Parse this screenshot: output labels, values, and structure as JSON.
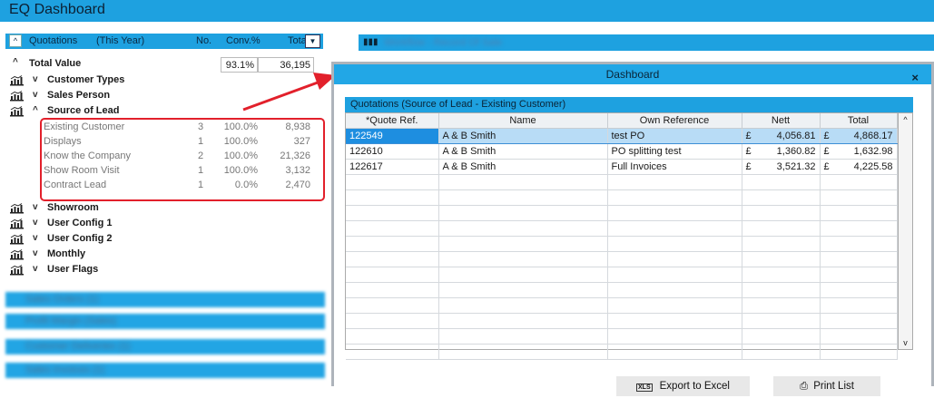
{
  "app": {
    "title": "EQ Dashboard"
  },
  "quotations": {
    "title": "Quotations",
    "period": "(This Year)",
    "col_no": "No.",
    "col_conv": "Conv.%",
    "col_total": "Total £",
    "total_label": "Total Value",
    "total_conv": "93.1%",
    "total_value": "36,195",
    "groups": [
      {
        "label": "Customer Types",
        "expanded": false
      },
      {
        "label": "Sales Person",
        "expanded": false
      },
      {
        "label": "Source of Lead",
        "expanded": true
      },
      {
        "label": "Showroom",
        "expanded": false
      },
      {
        "label": "User Config 1",
        "expanded": false
      },
      {
        "label": "User Config 2",
        "expanded": false
      },
      {
        "label": "Monthly",
        "expanded": false
      },
      {
        "label": "User Flags",
        "expanded": false
      }
    ],
    "source_of_lead": [
      {
        "name": "Existing Customer",
        "no": "3",
        "conv": "100.0%",
        "total": "8,938"
      },
      {
        "name": "Displays",
        "no": "1",
        "conv": "100.0%",
        "total": "327"
      },
      {
        "name": "Know the Company",
        "no": "2",
        "conv": "100.0%",
        "total": "21,326"
      },
      {
        "name": "Show Room Visit",
        "no": "1",
        "conv": "100.0%",
        "total": "3,132"
      },
      {
        "name": "Contract Lead",
        "no": "1",
        "conv": "0.0%",
        "total": "2,470"
      }
    ]
  },
  "dashboard": {
    "title": "Dashboard",
    "close": "×",
    "grid_title": "Quotations (Source of Lead - Existing Customer)",
    "columns": [
      "*Quote Ref.",
      "Name",
      "Own Reference",
      "Nett",
      "Total"
    ],
    "rows": [
      {
        "ref": "122549",
        "name": "A & B Smith",
        "own": "test PO",
        "cur1": "£",
        "nett": "4,056.81",
        "cur2": "£",
        "total": "4,868.17"
      },
      {
        "ref": "122610",
        "name": "A & B Smith",
        "own": "PO splitting test",
        "cur1": "£",
        "nett": "1,360.82",
        "cur2": "£",
        "total": "1,632.98"
      },
      {
        "ref": "122617",
        "name": "A & B Smith",
        "own": "Full Invoices",
        "cur1": "£",
        "nett": "3,521.32",
        "cur2": "£",
        "total": "4,225.58"
      }
    ],
    "export_label": "Export to Excel",
    "print_label": "Print List",
    "xls_icon_text": "XLS"
  },
  "colors": {
    "accent": "#1ea1e0",
    "highlight": "#e2202b",
    "selected": "#1e8ee0"
  }
}
